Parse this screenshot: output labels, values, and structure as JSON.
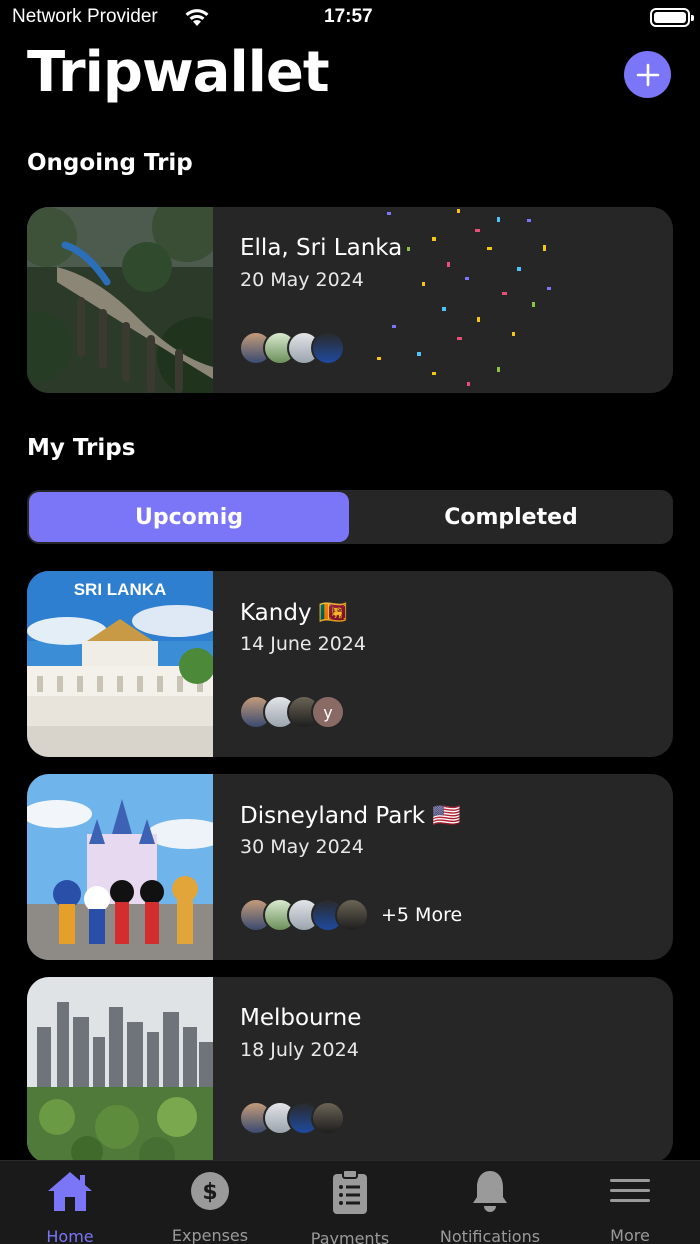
{
  "status_bar": {
    "carrier": "Network Provider",
    "time": "17:57"
  },
  "header": {
    "title": "Tripwallet",
    "add_icon": "plus-icon"
  },
  "ongoing": {
    "section_title": "Ongoing Trip",
    "trip": {
      "name": "Ella, Sri Lanka",
      "date": "20 May 2024"
    }
  },
  "my_trips": {
    "section_title": "My Trips",
    "tabs": [
      {
        "label": "Upcomig",
        "selected": true
      },
      {
        "label": "Completed",
        "selected": false
      }
    ],
    "trips": [
      {
        "name": "Kandy 🇱🇰",
        "date": "14 June 2024",
        "avatar_letter": "y"
      },
      {
        "name": "Disneyland Park 🇺🇸",
        "date": "30 May 2024",
        "more": "+5 More"
      },
      {
        "name": "Melbourne",
        "date": "18 July 2024"
      }
    ]
  },
  "tabbar": {
    "items": [
      {
        "label": "Home",
        "icon": "home-icon",
        "active": true
      },
      {
        "label": "Expenses",
        "icon": "dollar-icon",
        "active": false
      },
      {
        "label": "Payments",
        "icon": "clipboard-icon",
        "active": false
      },
      {
        "label": "Notifications",
        "icon": "bell-icon",
        "active": false
      },
      {
        "label": "More",
        "icon": "menu-icon",
        "active": false
      }
    ]
  },
  "colors": {
    "accent": "#7b76f7",
    "card": "#262626",
    "background": "#000000"
  }
}
